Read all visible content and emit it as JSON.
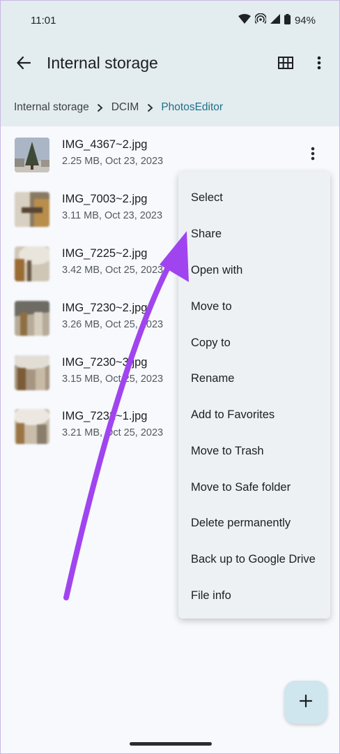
{
  "status_bar": {
    "time": "11:01",
    "battery": "94%"
  },
  "app_bar": {
    "title": "Internal storage"
  },
  "breadcrumb": {
    "items": [
      "Internal storage",
      "DCIM",
      "PhotosEditor"
    ]
  },
  "files": [
    {
      "name": "IMG_4367~2.jpg",
      "meta": "2.25 MB, Oct 23, 2023"
    },
    {
      "name": "IMG_7003~2.jpg",
      "meta": "3.11 MB, Oct 23, 2023"
    },
    {
      "name": "IMG_7225~2.jpg",
      "meta": "3.42 MB, Oct 25, 2023"
    },
    {
      "name": "IMG_7230~2.jpg",
      "meta": "3.26 MB, Oct 25, 2023"
    },
    {
      "name": "IMG_7230~3.jpg",
      "meta": "3.15 MB, Oct 25, 2023"
    },
    {
      "name": "IMG_7232~1.jpg",
      "meta": "3.21 MB, Oct 25, 2023"
    }
  ],
  "menu": {
    "items": [
      "Select",
      "Share",
      "Open with",
      "Move to",
      "Copy to",
      "Rename",
      "Add to Favorites",
      "Move to Trash",
      "Move to Safe folder",
      "Delete permanently",
      "Back up to Google Drive",
      "File info"
    ]
  },
  "colors": {
    "header_bg": "#e3ecef",
    "accent": "#1f6f8a",
    "arrow": "#a044f0",
    "fab_bg": "#cfe6ee"
  }
}
